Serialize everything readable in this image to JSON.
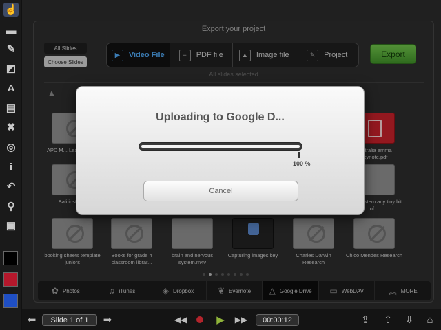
{
  "toolbar": {
    "tools": [
      {
        "name": "touch-pointer-icon",
        "glyph": "☝"
      },
      {
        "name": "add-screen-icon",
        "glyph": "▬"
      },
      {
        "name": "pen-icon",
        "glyph": "✎"
      },
      {
        "name": "shape-icon",
        "glyph": "◩"
      },
      {
        "name": "text-icon",
        "glyph": "A"
      },
      {
        "name": "add-slide-icon",
        "glyph": "▤"
      },
      {
        "name": "delete-icon",
        "glyph": "✖"
      },
      {
        "name": "laser-pointer-icon",
        "glyph": "◎"
      },
      {
        "name": "text-box-icon",
        "glyph": "i"
      },
      {
        "name": "undo-icon",
        "glyph": "↶"
      },
      {
        "name": "zoom-icon",
        "glyph": "⚲"
      },
      {
        "name": "screen-capture-icon",
        "glyph": "▣"
      }
    ],
    "swatches": [
      "#000000",
      "#b5182c",
      "#1f4fc4"
    ]
  },
  "panel": {
    "title": "Export your project",
    "all_slides_label": "All Slides",
    "choose_slides_label": "Choose Slides",
    "tabs": [
      {
        "name": "tab-video-file",
        "label": "Video File",
        "glyph": "▶",
        "active": true
      },
      {
        "name": "tab-pdf-file",
        "label": "PDF file",
        "glyph": "≡",
        "active": false
      },
      {
        "name": "tab-image-file",
        "label": "Image file",
        "glyph": "▲",
        "active": false
      },
      {
        "name": "tab-project",
        "label": "Project",
        "glyph": "✎",
        "active": false
      }
    ],
    "export_label": "Export",
    "selection_note": "All slides selected",
    "files": [
      {
        "label": "APD M... Learning A...",
        "kind": "no"
      },
      {
        "label": "Bali institu...",
        "kind": "no"
      },
      {
        "label": "australia emma keynote.pdf",
        "kind": "pdf"
      },
      {
        "label": "body system any tiny bit of...",
        "kind": "blank"
      },
      {
        "label": "booking sheets template juniors",
        "kind": "no"
      },
      {
        "label": "Books for grade 4 classroom librar...",
        "kind": "no"
      },
      {
        "label": "brain and nervous system.m4v",
        "kind": "blank"
      },
      {
        "label": "Capturing images.key",
        "kind": "keynote"
      },
      {
        "label": "Charles Darwin Research",
        "kind": "no"
      },
      {
        "label": "Chico Mendes Research",
        "kind": "no"
      }
    ],
    "services": [
      {
        "name": "service-photos",
        "label": "Photos",
        "glyph": "✿",
        "active": false
      },
      {
        "name": "service-itunes",
        "label": "iTunes",
        "glyph": "♫",
        "active": false
      },
      {
        "name": "service-dropbox",
        "label": "Dropbox",
        "glyph": "◈",
        "active": false
      },
      {
        "name": "service-evernote",
        "label": "Evernote",
        "glyph": "❦",
        "active": false
      },
      {
        "name": "service-google-drive",
        "label": "Google Drive",
        "glyph": "△",
        "active": true
      },
      {
        "name": "service-webdav",
        "label": "WebDAV",
        "glyph": "▭",
        "active": false
      },
      {
        "name": "service-more",
        "label": "MORE",
        "glyph": "︽",
        "active": false
      }
    ]
  },
  "bottombar": {
    "slide_label": "Slide 1 of 1",
    "time": "00:00:12"
  },
  "modal": {
    "title": "Uploading to Google D...",
    "progress": 1.0,
    "progress_text": "100 %",
    "cancel_label": "Cancel"
  }
}
